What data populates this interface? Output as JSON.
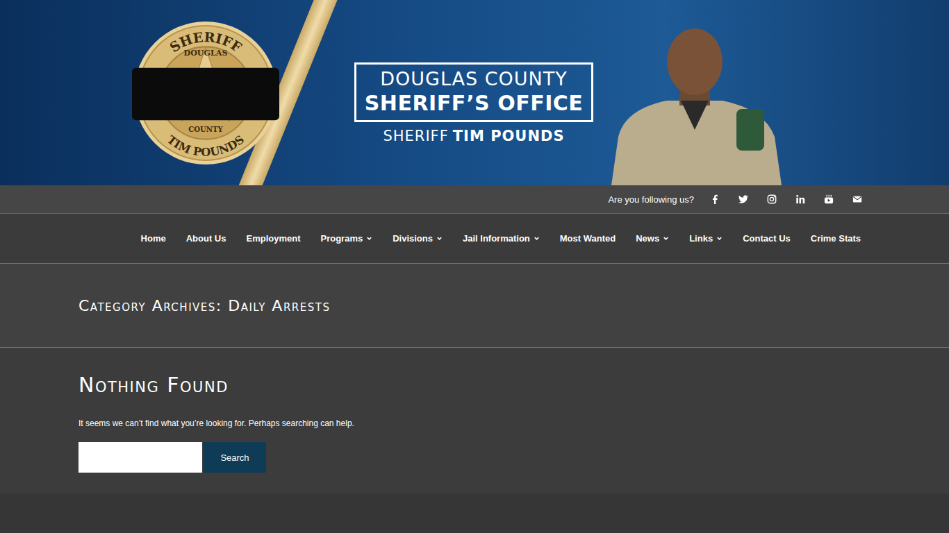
{
  "header": {
    "badge": {
      "top": "SHERIFF",
      "upper": "DOUGLAS",
      "lower": "COUNTY",
      "bottom": "TIM POUNDS",
      "mourning_band": true
    },
    "title_lines": [
      "DOUGLAS COUNTY",
      "SHERIFF’S OFFICE"
    ],
    "subtitle_prefix": "SHERIFF",
    "subtitle_name": "TIM POUNDS"
  },
  "social": {
    "label": "Are you following us?",
    "icons": [
      {
        "kind": "facebook"
      },
      {
        "kind": "twitter"
      },
      {
        "kind": "instagram"
      },
      {
        "kind": "linkedin"
      },
      {
        "kind": "youtube"
      },
      {
        "kind": "email"
      }
    ]
  },
  "nav": [
    {
      "label": "Home",
      "has_dropdown": false
    },
    {
      "label": "About Us",
      "has_dropdown": false
    },
    {
      "label": "Employment",
      "has_dropdown": false
    },
    {
      "label": "Programs",
      "has_dropdown": true
    },
    {
      "label": "Divisions",
      "has_dropdown": true
    },
    {
      "label": "Jail Information",
      "has_dropdown": true
    },
    {
      "label": "Most Wanted",
      "has_dropdown": false
    },
    {
      "label": "News",
      "has_dropdown": true
    },
    {
      "label": "Links",
      "has_dropdown": true
    },
    {
      "label": "Contact Us",
      "has_dropdown": false
    },
    {
      "label": "Crime Stats",
      "has_dropdown": false
    }
  ],
  "page_title": "Category Archives: Daily Arrests",
  "content": {
    "heading": "Nothing Found",
    "message": "It seems we can’t find what you’re looking for. Perhaps searching can help.",
    "search": {
      "value": "",
      "button": "Search"
    }
  }
}
